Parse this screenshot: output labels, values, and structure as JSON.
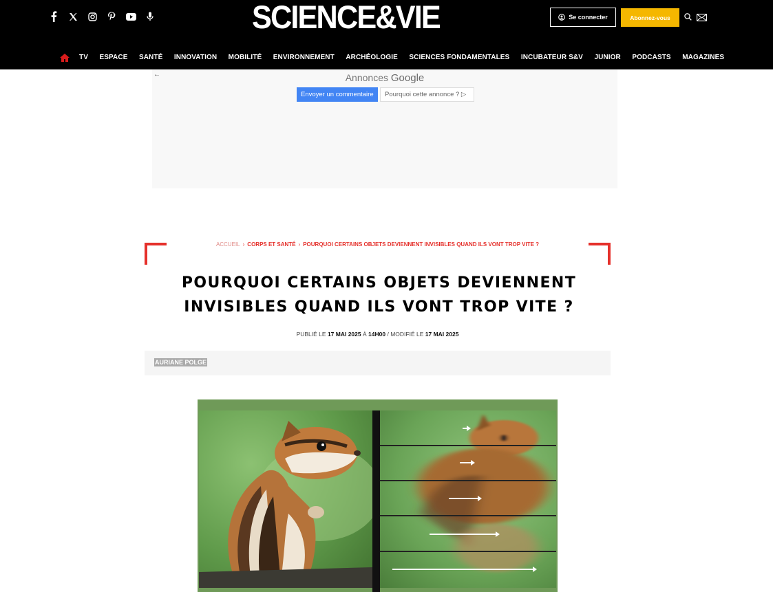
{
  "header": {
    "logo": "SCIENCE&VIE",
    "login_label": "Se connecter",
    "subscribe_label": "Abonnez-vous",
    "socials": [
      "facebook-icon",
      "x-icon",
      "instagram-icon",
      "pinterest-icon",
      "youtube-icon",
      "microphone-icon"
    ]
  },
  "nav": {
    "items": [
      "TV",
      "ESPACE",
      "SANTÉ",
      "INNOVATION",
      "MOBILITÉ",
      "ENVIRONNEMENT",
      "ARCHÉOLOGIE",
      "SCIENCES FONDAMENTALES",
      "INCUBATEUR S&V",
      "JUNIOR",
      "PODCASTS",
      "MAGAZINES"
    ]
  },
  "ad": {
    "title_prefix": "Annonces",
    "title_brand": "Google",
    "feedback_label": "Envoyer un commentaire",
    "why_label": "Pourquoi cette annonce ? ▷"
  },
  "article": {
    "breadcrumb": {
      "home": "ACCUEIL",
      "category": "CORPS ET SANTÉ",
      "current": "POURQUOI CERTAINS OBJETS DEVIENNENT INVISIBLES QUAND ILS VONT TROP VITE ?"
    },
    "title_line1": "POURQUOI CERTAINS OBJETS DEVIENNENT",
    "title_line2": "INVISIBLES QUAND ILS VONT TROP VITE ?",
    "meta": {
      "published_prefix": "PUBLIÉ LE",
      "published_date": "17 MAI 2025",
      "at": "À",
      "published_time": "14H00",
      "modified_prefix": "/ MODIFIÉ LE",
      "modified_date": "17 MAI 2025"
    },
    "author": "AURIANE POLGE"
  }
}
